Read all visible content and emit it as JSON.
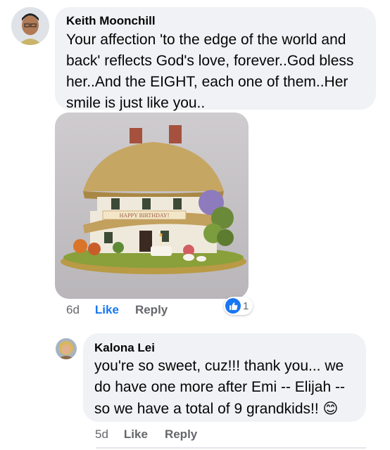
{
  "comment1": {
    "author": "Keith Moonchill",
    "text": "Your affection 'to the edge of the world and back' reflects God's love, forever..God bless her..And the EIGHT, each one of them..Her smile is just like you..",
    "time": "6d",
    "like_label": "Like",
    "reply_label": "Reply",
    "reaction_count": "1",
    "photo_banner": "HAPPY BIRTHDAY!"
  },
  "reply1": {
    "author": "Kalona Lei",
    "text": "you're so sweet, cuz!!! thank you... we do have one more after Emi -- Elijah -- so we have a total of 9 grandkids!!",
    "emoji": "😊",
    "time": "5d",
    "like_label": "Like",
    "reply_label": "Reply"
  },
  "colors": {
    "link_blue": "#1877f2",
    "meta_gray": "#65676b",
    "bubble_bg": "#f0f2f5"
  },
  "icons": {
    "reaction": "like-thumbs-up-icon",
    "emoji": "smiling-face-emoji-icon"
  }
}
